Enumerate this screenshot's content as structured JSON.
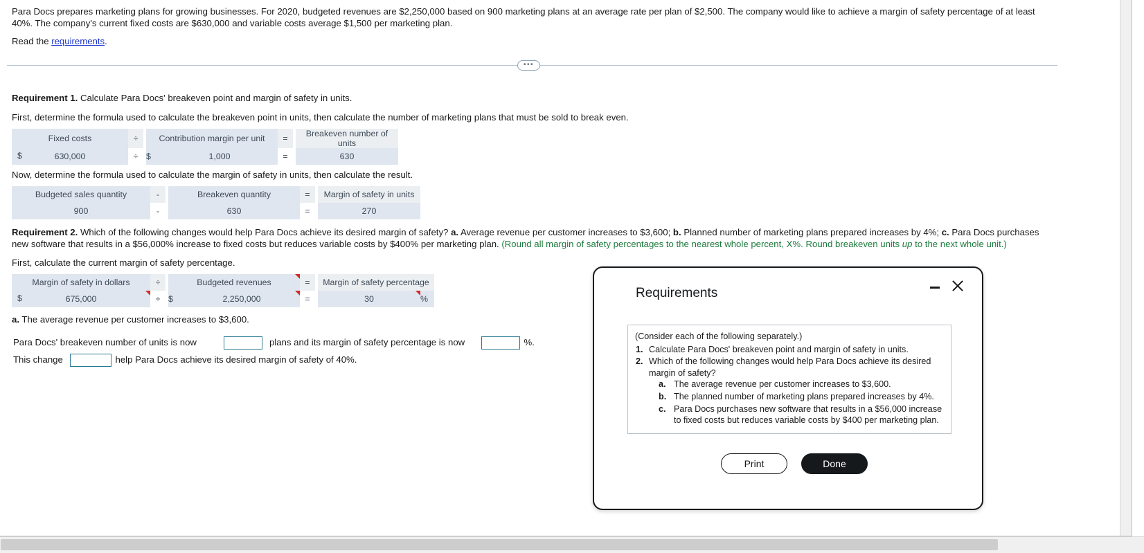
{
  "problem": {
    "statement": "Para Docs prepares marketing plans for growing businesses. For 2020, budgeted revenues are $2,250,000 based on 900 marketing plans at an average rate per plan of $2,500. The company would like to achieve a margin of safety percentage of at least 40%. The company's current fixed costs are $630,000 and variable costs average $1,500 per marketing plan.",
    "read_prefix": "Read the ",
    "read_link": "requirements",
    "read_suffix": "."
  },
  "divider": {
    "handle": "•••"
  },
  "requirement1": {
    "label": "Requirement 1.",
    "text": " Calculate Para Docs' breakeven point and margin of safety in units.",
    "prompt1": "First, determine the formula used to calculate the breakeven point in units, then calculate the number of marketing plans that must be sold to break even.",
    "table1": {
      "headers": [
        "Fixed costs",
        "÷",
        "Contribution margin per unit",
        "=",
        "Breakeven number of units"
      ],
      "values": [
        "630,000",
        "÷",
        "1,000",
        "=",
        "630"
      ],
      "currency1": "$",
      "currency2": "$"
    },
    "prompt2": "Now, determine the formula used to calculate the margin of safety in units, then calculate the result.",
    "table2": {
      "headers": [
        "Budgeted sales quantity",
        "-",
        "Breakeven quantity",
        "=",
        "Margin of safety in units"
      ],
      "values": [
        "900",
        "-",
        "630",
        "=",
        "270"
      ]
    }
  },
  "requirement2": {
    "label": "Requirement 2.",
    "text": " Which of the following changes would help Para Docs achieve its desired margin of safety? ",
    "opt_a_label": "a.",
    "opt_a_text": " Average revenue per customer increases to $3,600; ",
    "opt_b_label": "b.",
    "opt_b_text": " Planned number of marketing plans prepared increases by 4%; ",
    "opt_c_label": "c.",
    "opt_c_text": " Para Docs purchases new software that results in a $56,000% increase to fixed costs but reduces variable costs by $400% per marketing plan. ",
    "note_part1": "(Round all margin of safety percentages to the nearest whole percent, X%. Round breakeven units ",
    "note_italic": "up",
    "note_part2": " to the next whole unit.)",
    "prompt1": "First, calculate the current margin of safety percentage.",
    "table3": {
      "headers": [
        "Margin of safety in dollars",
        "÷",
        "Budgeted revenues",
        "=",
        "Margin of safety percentage"
      ],
      "values": [
        "675,000",
        "÷",
        "2,250,000",
        "=",
        "30"
      ],
      "currency1": "$",
      "currency2": "$",
      "percent_sign": "%"
    },
    "sub_a_label": "a.",
    "sub_a_text": " The average revenue per customer increases to $3,600.",
    "answer_line1_part1": "Para Docs' breakeven number of units is now",
    "answer_line1_value": "",
    "answer_line1_part2": "plans and its margin of safety percentage is now",
    "answer_line1_value2": "",
    "answer_line1_part3": "%.",
    "answer_line2_part1": "This change",
    "answer_line2_value": "",
    "answer_line2_part2": "help Para Docs achieve its desired margin of safety of 40%."
  },
  "modal": {
    "title": "Requirements",
    "minimize_icon": "minimize-icon",
    "close_icon": "close-icon",
    "lead": "(Consider each of the following separately.)",
    "items": [
      {
        "num": "1.",
        "text": "Calculate Para Docs' breakeven point and margin of safety in units."
      },
      {
        "num": "2.",
        "text": "Which of the following changes would help Para Docs achieve its desired margin of safety?",
        "sub": [
          {
            "num": "a.",
            "text": "The average revenue per customer increases to $3,600."
          },
          {
            "num": "b.",
            "text": "The planned number of marketing plans prepared increases by 4%."
          },
          {
            "num": "c.",
            "text": "Para Docs purchases new software that results in a $56,000 increase to fixed costs but reduces variable costs by $400 per marketing plan."
          }
        ]
      }
    ],
    "print_label": "Print",
    "done_label": "Done"
  },
  "colors": {
    "link": "#1a33cc",
    "note_green": "#1d7a3c",
    "table_blue": "#dfe6f0",
    "table_gray": "#eceff2",
    "flag_red": "#d62828",
    "input_border": "#2a7a93",
    "button_dark": "#16191c"
  }
}
